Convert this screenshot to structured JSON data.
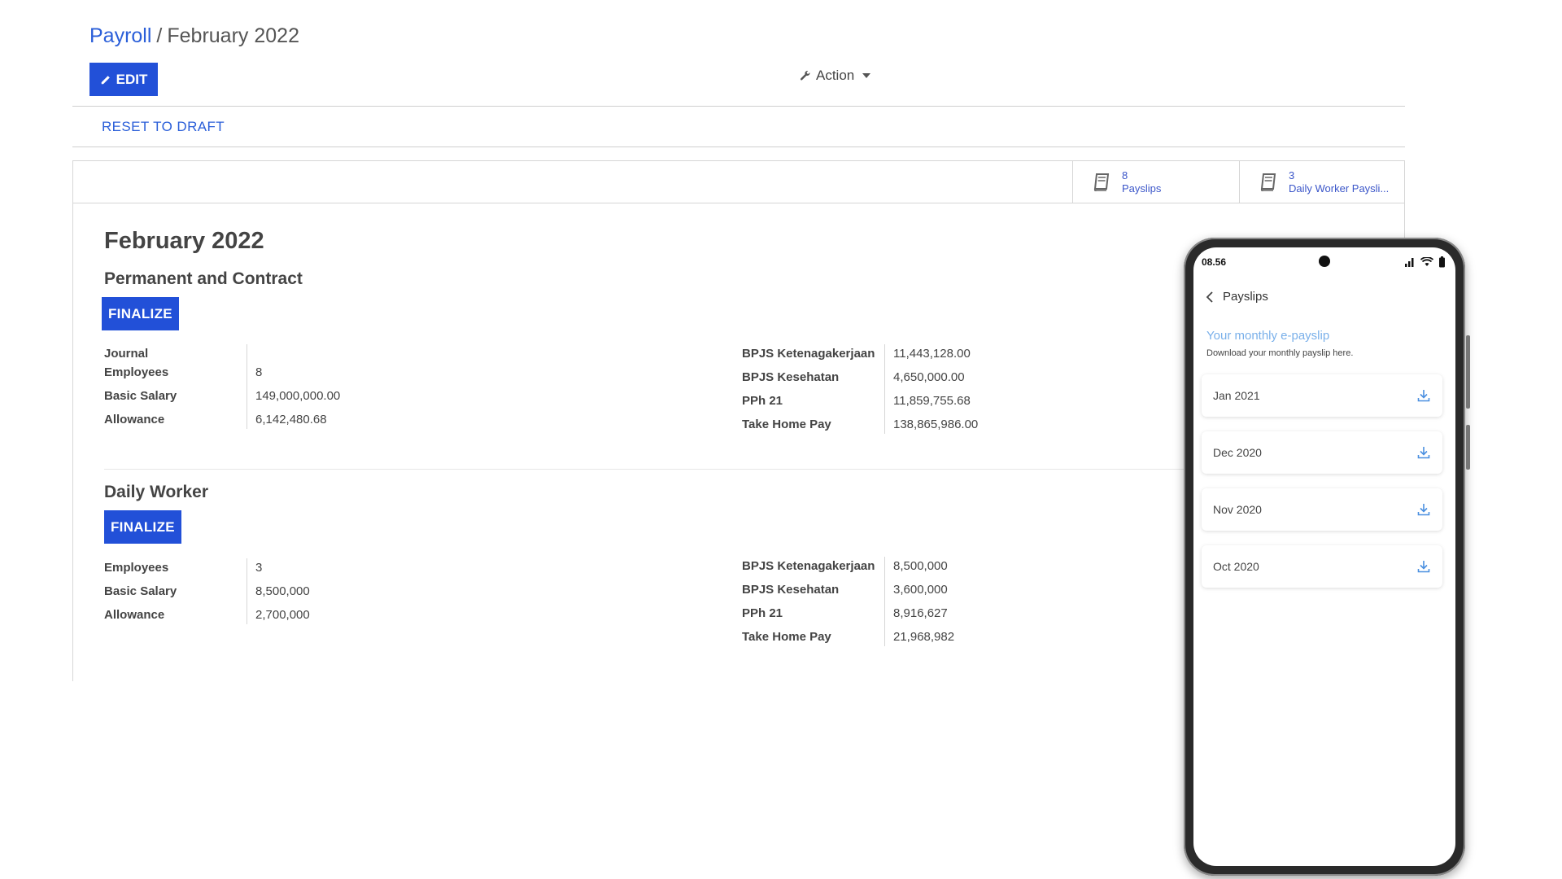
{
  "breadcrumb": {
    "parent": "Payroll",
    "separator": "/",
    "current": "February 2022"
  },
  "toolbar": {
    "edit_label": "EDIT",
    "action_label": "Action"
  },
  "status": {
    "reset_label": "RESET TO DRAFT"
  },
  "smart_buttons": [
    {
      "count": "8",
      "label": "Payslips"
    },
    {
      "count": "3",
      "label": "Daily Worker Paysli..."
    }
  ],
  "sheet": {
    "title": "February 2022",
    "permanent": {
      "title": "Permanent and Contract",
      "finalize_label": "FINALIZE",
      "left": [
        {
          "label": "Journal",
          "value": ""
        },
        {
          "label": "Employees",
          "value": "8"
        },
        {
          "label": "Basic Salary",
          "value": "149,000,000.00"
        },
        {
          "label": "Allowance",
          "value": "6,142,480.68"
        }
      ],
      "right": [
        {
          "label": "BPJS Ketenagakerjaan",
          "value": "11,443,128.00"
        },
        {
          "label": "BPJS Kesehatan",
          "value": "4,650,000.00"
        },
        {
          "label": "PPh 21",
          "value": "11,859,755.68"
        },
        {
          "label": "Take Home Pay",
          "value": "138,865,986.00"
        }
      ]
    },
    "daily": {
      "title": "Daily Worker",
      "finalize_label": "FINALIZE",
      "left": [
        {
          "label": "Employees",
          "value": "3"
        },
        {
          "label": "Basic Salary",
          "value": "8,500,000"
        },
        {
          "label": "Allowance",
          "value": "2,700,000"
        }
      ],
      "right": [
        {
          "label": "BPJS Ketenagakerjaan",
          "value": "8,500,000"
        },
        {
          "label": "BPJS Kesehatan",
          "value": "3,600,000"
        },
        {
          "label": "PPh 21",
          "value": "8,916,627"
        },
        {
          "label": "Take Home Pay",
          "value": "21,968,982"
        }
      ]
    }
  },
  "phone": {
    "time": "08.56",
    "header_title": "Payslips",
    "heading": "Your monthly e-payslip",
    "subheading": "Download your monthly payslip here.",
    "payslips": [
      "Jan 2021",
      "Dec 2020",
      "Nov 2020",
      "Oct 2020"
    ]
  },
  "colors": {
    "primary": "#2250d8",
    "link": "#2b5fd9",
    "phone_accent": "#7ab0ea"
  }
}
